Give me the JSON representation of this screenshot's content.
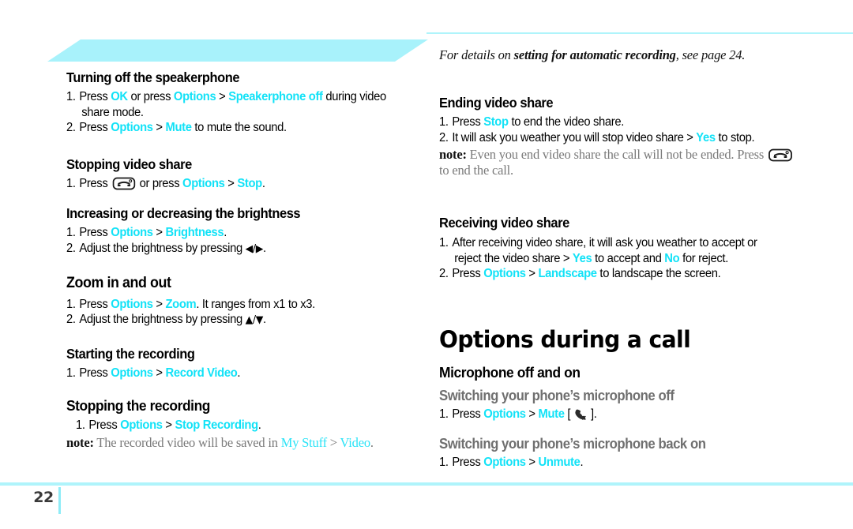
{
  "page": {
    "number": "22",
    "accent_cyan": "#12e2f7",
    "accent_cyan_light": "#aff4fb",
    "gray_text": "#7a7a7a"
  },
  "left_column": {
    "sections": [
      {
        "heading": "Turning off the speakerphone",
        "steps": [
          {
            "num": "1.",
            "parts": [
              {
                "t": "Press ",
                "s": "plain"
              },
              {
                "t": "OK",
                "s": "cyan"
              },
              {
                "t": " or press ",
                "s": "plain"
              },
              {
                "t": "Options",
                "s": "cyan"
              },
              {
                "t": " > ",
                "s": "plain"
              },
              {
                "t": "Speakerphone off",
                "s": "cyan"
              },
              {
                "t": " during video share mode.",
                "s": "plain"
              }
            ]
          },
          {
            "num": "2.",
            "parts": [
              {
                "t": "Press ",
                "s": "plain"
              },
              {
                "t": "Options",
                "s": "cyan"
              },
              {
                "t": " > ",
                "s": "plain"
              },
              {
                "t": "Mute",
                "s": "cyan"
              },
              {
                "t": " to mute the sound.",
                "s": "plain"
              }
            ]
          }
        ]
      },
      {
        "heading": "Stopping video share",
        "steps": [
          {
            "num": "1.",
            "parts": [
              {
                "t": "Press ",
                "s": "plain"
              },
              {
                "t": "end-call-key-icon",
                "s": "icon-endcall"
              },
              {
                "t": " or press ",
                "s": "plain"
              },
              {
                "t": "Options",
                "s": "cyan"
              },
              {
                "t": " > ",
                "s": "plain"
              },
              {
                "t": "Stop",
                "s": "cyan"
              },
              {
                "t": ".",
                "s": "plain"
              }
            ]
          }
        ]
      },
      {
        "heading": "Increasing or decreasing the brightness",
        "steps": [
          {
            "num": "1.",
            "parts": [
              {
                "t": "Press ",
                "s": "plain"
              },
              {
                "t": "Options",
                "s": "cyan"
              },
              {
                "t": " > ",
                "s": "plain"
              },
              {
                "t": "Brightness",
                "s": "cyan"
              },
              {
                "t": ".",
                "s": "plain"
              }
            ]
          },
          {
            "num": "2.",
            "parts": [
              {
                "t": "Adjust the brightness by pressing ",
                "s": "plain"
              },
              {
                "t": "◀/▶",
                "s": "glyph"
              },
              {
                "t": ".",
                "s": "plain"
              }
            ]
          }
        ]
      },
      {
        "heading": "Zoom in and out",
        "steps": [
          {
            "num": "1.",
            "parts": [
              {
                "t": "Press ",
                "s": "plain"
              },
              {
                "t": "Options",
                "s": "cyan"
              },
              {
                "t": " > ",
                "s": "plain"
              },
              {
                "t": "Zoom",
                "s": "cyan"
              },
              {
                "t": ". It ranges from x1 to x3.",
                "s": "plain"
              }
            ]
          },
          {
            "num": "2.",
            "parts": [
              {
                "t": "Adjust the brightness by pressing ",
                "s": "plain"
              },
              {
                "t": "▲/▼",
                "s": "glyph"
              },
              {
                "t": ".",
                "s": "plain"
              }
            ]
          }
        ]
      },
      {
        "heading": "Starting the recording",
        "steps": [
          {
            "num": "1.",
            "parts": [
              {
                "t": "Press ",
                "s": "plain"
              },
              {
                "t": "Options",
                "s": "cyan"
              },
              {
                "t": " > ",
                "s": "plain"
              },
              {
                "t": "Record Video",
                "s": "cyan"
              },
              {
                "t": ".",
                "s": "plain"
              }
            ]
          }
        ]
      },
      {
        "heading": "Stopping the recording",
        "steps": [
          {
            "num": "1.",
            "parts": [
              {
                "t": "Press ",
                "s": "plain"
              },
              {
                "t": "Options",
                "s": "cyan"
              },
              {
                "t": " > ",
                "s": "plain"
              },
              {
                "t": "Stop Recording",
                "s": "cyan"
              },
              {
                "t": ".",
                "s": "plain"
              }
            ]
          }
        ],
        "note": [
          {
            "t": "note:",
            "s": "bold"
          },
          {
            "t": " The recorded video will be saved in ",
            "s": "plain"
          },
          {
            "t": "My Stuff",
            "s": "cyan"
          },
          {
            "t": " > ",
            "s": "plain"
          },
          {
            "t": "Video",
            "s": "cyan"
          },
          {
            "t": ".",
            "s": "plain"
          }
        ]
      }
    ]
  },
  "right_column": {
    "intro_ref": [
      {
        "t": "For details on ",
        "s": "italic"
      },
      {
        "t": "setting for automatic recording",
        "s": "italic-bold"
      },
      {
        "t": ", see page 24.",
        "s": "italic"
      }
    ],
    "sections": [
      {
        "heading": "Ending video share",
        "steps": [
          {
            "num": "1.",
            "parts": [
              {
                "t": "Press ",
                "s": "plain"
              },
              {
                "t": "Stop",
                "s": "cyan"
              },
              {
                "t": " to end the video share.",
                "s": "plain"
              }
            ]
          },
          {
            "num": "2.",
            "parts": [
              {
                "t": "It will ask you weather you will stop video share > ",
                "s": "plain"
              },
              {
                "t": "Yes",
                "s": "cyan"
              },
              {
                "t": " to stop.",
                "s": "plain"
              }
            ]
          }
        ],
        "note": [
          {
            "t": "note:",
            "s": "bold"
          },
          {
            "t": " Even you end video share the call will not be ended. Press ",
            "s": "plain"
          },
          {
            "t": "end-call-key-icon",
            "s": "icon-endcall"
          },
          {
            "t": " to end the call.",
            "s": "plain"
          }
        ]
      },
      {
        "heading": "Receiving video share",
        "steps": [
          {
            "num": "1.",
            "parts": [
              {
                "t": "After receiving video share, it will ask you weather to accept or reject the video share > ",
                "s": "plain"
              },
              {
                "t": "Yes",
                "s": "cyan"
              },
              {
                "t": " to accept and ",
                "s": "plain"
              },
              {
                "t": "No",
                "s": "cyan"
              },
              {
                "t": " for reject.",
                "s": "plain"
              }
            ]
          },
          {
            "num": "2.",
            "parts": [
              {
                "t": "Press ",
                "s": "plain"
              },
              {
                "t": "Options",
                "s": "cyan"
              },
              {
                "t": " > ",
                "s": "plain"
              },
              {
                "t": "Landscape",
                "s": "cyan"
              },
              {
                "t": " to landscape the screen.",
                "s": "plain"
              }
            ]
          }
        ]
      }
    ],
    "chapter_title": "Options during a call",
    "sub_heading": "Microphone off and on",
    "gray_sections": [
      {
        "heading": "Switching your phone’s microphone off",
        "steps": [
          {
            "num": "1.",
            "parts": [
              {
                "t": "Press ",
                "s": "plain"
              },
              {
                "t": "Options",
                "s": "cyan"
              },
              {
                "t": " > ",
                "s": "plain"
              },
              {
                "t": "Mute",
                "s": "cyan"
              },
              {
                "t": " [ ",
                "s": "plain"
              },
              {
                "t": "mute-microphone-icon",
                "s": "icon-mute"
              },
              {
                "t": " ].",
                "s": "plain"
              }
            ]
          }
        ]
      },
      {
        "heading": "Switching your phone’s microphone back on",
        "steps": [
          {
            "num": "1.",
            "parts": [
              {
                "t": "Press ",
                "s": "plain"
              },
              {
                "t": "Options",
                "s": "cyan"
              },
              {
                "t": " > ",
                "s": "plain"
              },
              {
                "t": "Unmute",
                "s": "cyan"
              },
              {
                "t": ".",
                "s": "plain"
              }
            ]
          }
        ]
      }
    ]
  }
}
